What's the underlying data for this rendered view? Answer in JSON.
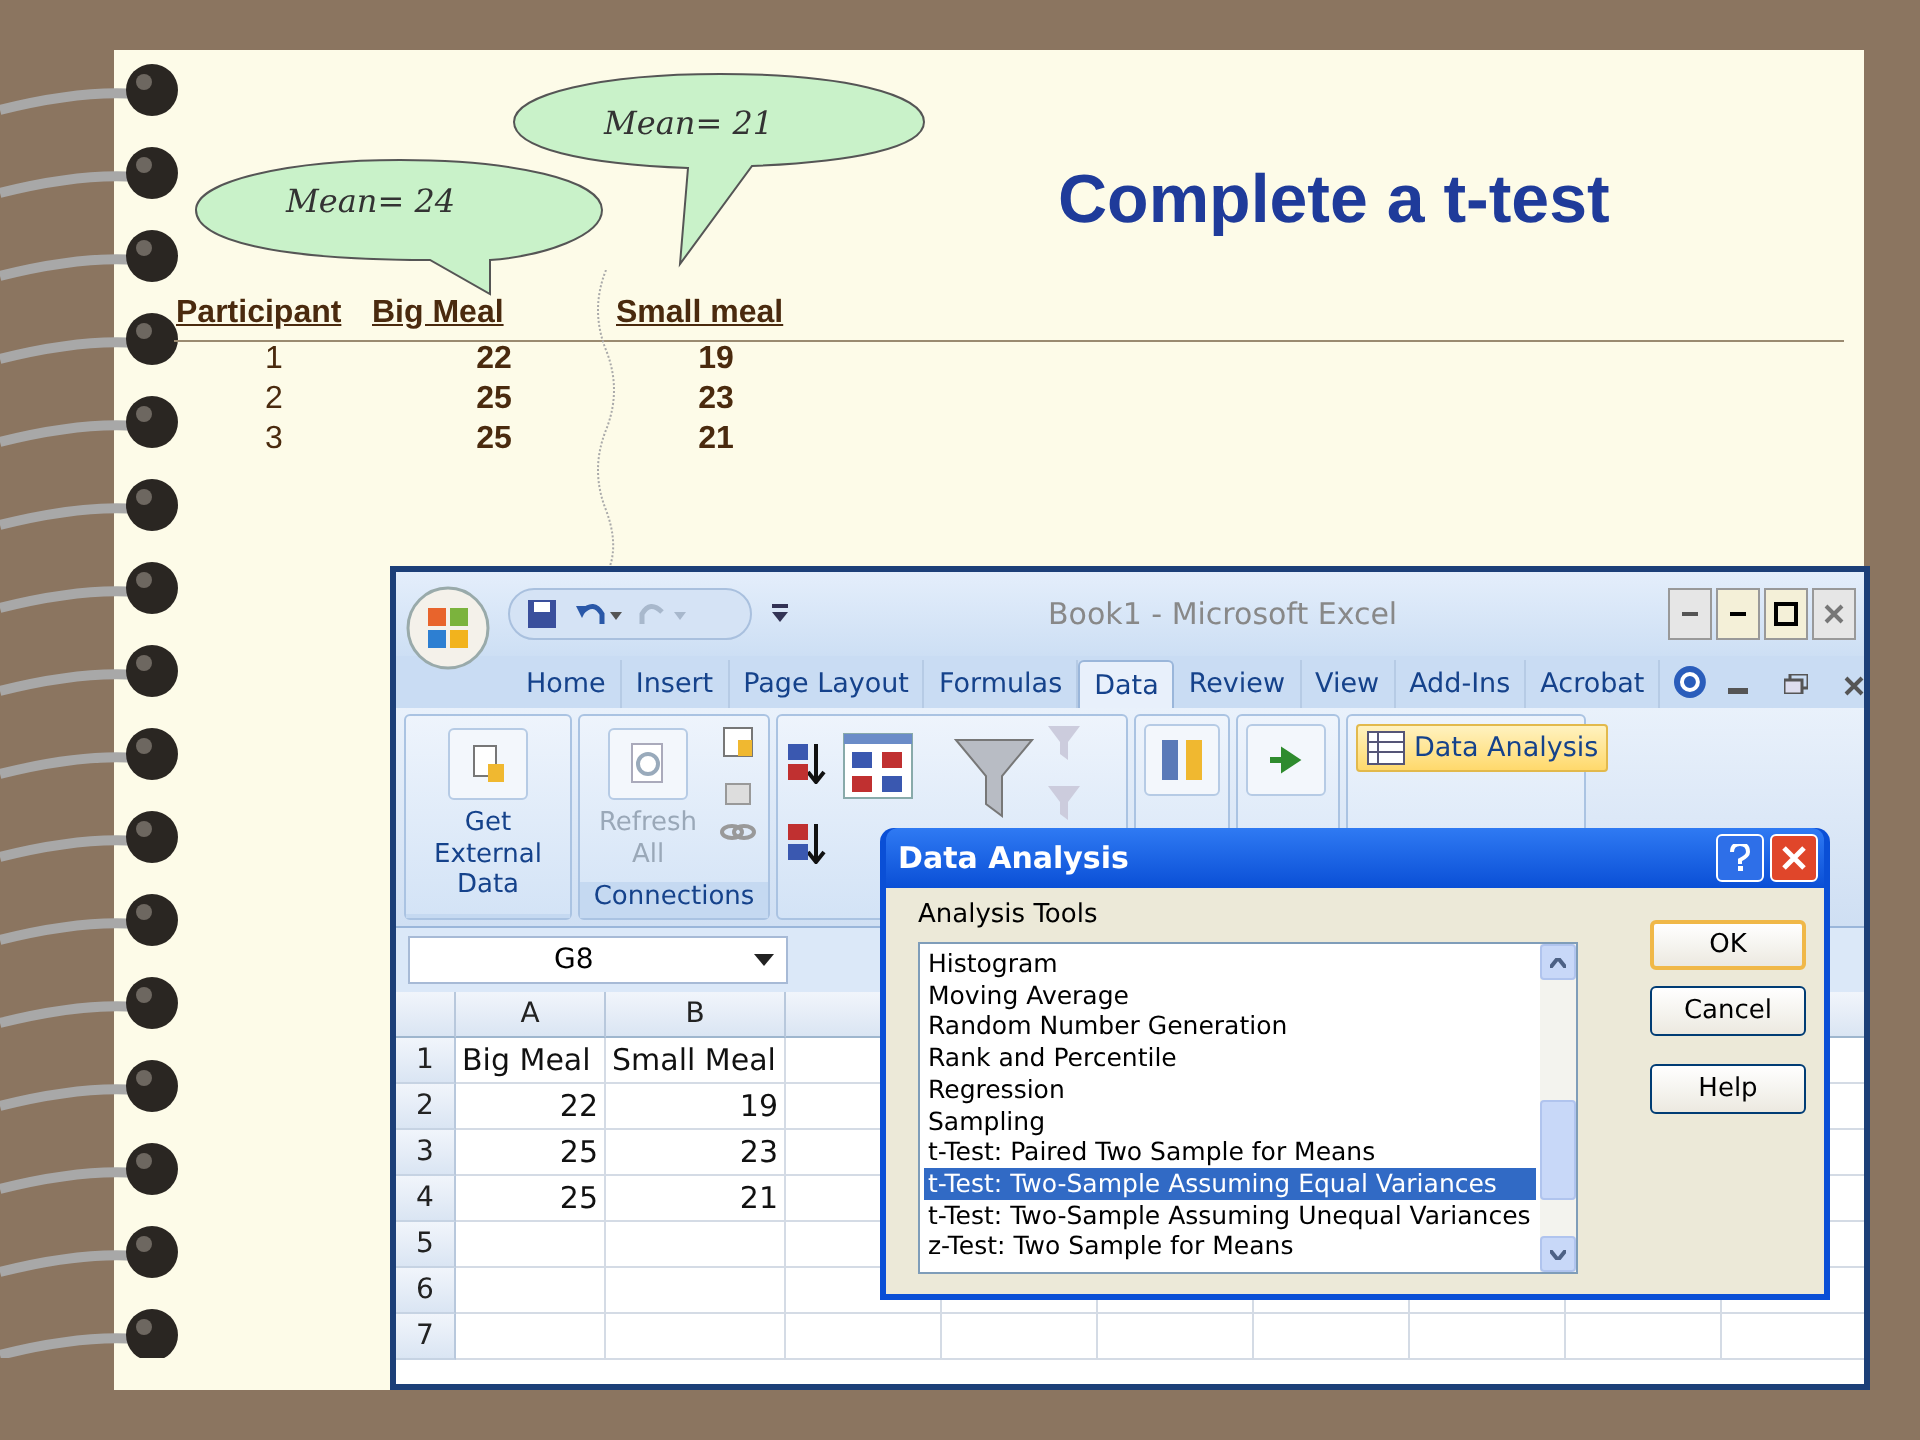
{
  "slide": {
    "title": "Complete a t-test",
    "bubbles": [
      {
        "text": "Mean= 24"
      },
      {
        "text": "Mean= 21"
      }
    ],
    "table": {
      "columns": [
        "Participant",
        "Big Meal",
        "Small meal"
      ],
      "rows": [
        [
          "1",
          "22",
          "19"
        ],
        [
          "2",
          "25",
          "23"
        ],
        [
          "3",
          "25",
          "21"
        ]
      ]
    }
  },
  "excel": {
    "title": "Book1 - Microsoft Excel",
    "tabs": [
      {
        "label": "Home",
        "selected": false
      },
      {
        "label": "Insert",
        "selected": false
      },
      {
        "label": "Page Layout",
        "selected": false
      },
      {
        "label": "Formulas",
        "selected": false
      },
      {
        "label": "Data",
        "selected": true
      },
      {
        "label": "Review",
        "selected": false
      },
      {
        "label": "View",
        "selected": false
      },
      {
        "label": "Add-Ins",
        "selected": false
      },
      {
        "label": "Acrobat",
        "selected": false
      }
    ],
    "ribbon": {
      "get_external_data": {
        "label": "Get External Data",
        "disabled": false
      },
      "refresh_all": {
        "label": "Refresh All",
        "disabled": true
      },
      "connections_label": "Connections",
      "data_analysis": {
        "label": "Data Analysis",
        "highlighted": true
      }
    },
    "name_box": "G8",
    "sheet": {
      "columns": [
        "A",
        "B"
      ],
      "rows": [
        {
          "header": "1",
          "cells": [
            {
              "value": "Big Meal",
              "kind": "text"
            },
            {
              "value": "Small Meal",
              "kind": "text"
            }
          ]
        },
        {
          "header": "2",
          "cells": [
            {
              "value": "22",
              "kind": "number"
            },
            {
              "value": "19",
              "kind": "number"
            }
          ]
        },
        {
          "header": "3",
          "cells": [
            {
              "value": "25",
              "kind": "number"
            },
            {
              "value": "23",
              "kind": "number"
            }
          ]
        },
        {
          "header": "4",
          "cells": [
            {
              "value": "25",
              "kind": "number"
            },
            {
              "value": "21",
              "kind": "number"
            }
          ]
        },
        {
          "header": "5"
        },
        {
          "header": "6"
        },
        {
          "header": "7"
        }
      ]
    }
  },
  "dialog": {
    "title": "Data Analysis",
    "list_label": "Analysis Tools",
    "items": [
      {
        "label": "Histogram",
        "selected": false
      },
      {
        "label": "Moving Average",
        "selected": false
      },
      {
        "label": "Random Number Generation",
        "selected": false
      },
      {
        "label": "Rank and Percentile",
        "selected": false
      },
      {
        "label": "Regression",
        "selected": false
      },
      {
        "label": "Sampling",
        "selected": false
      },
      {
        "label": "t-Test: Paired Two Sample for Means",
        "selected": false
      },
      {
        "label": "t-Test: Two-Sample Assuming Equal Variances",
        "selected": true
      },
      {
        "label": "t-Test: Two-Sample Assuming Unequal Variances",
        "selected": false
      },
      {
        "label": "z-Test: Two Sample for Means",
        "selected": false
      }
    ],
    "buttons": [
      {
        "label": "OK",
        "default": true
      },
      {
        "label": "Cancel",
        "default": false
      },
      {
        "label": "Help",
        "default": false
      }
    ]
  }
}
